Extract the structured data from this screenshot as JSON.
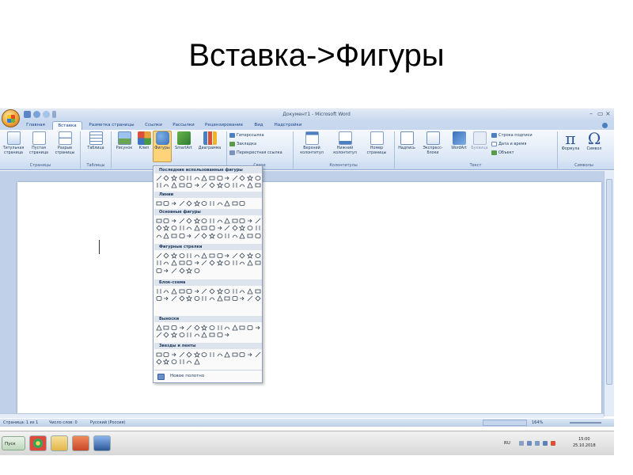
{
  "slide": {
    "title": "Вставка->Фигуры"
  },
  "window": {
    "title": "Документ1 - Microsoft Word",
    "controls": [
      "–",
      "▭",
      "×"
    ]
  },
  "tabs": [
    {
      "label": "Главная",
      "active": false
    },
    {
      "label": "Вставка",
      "active": true
    },
    {
      "label": "Разметка страницы",
      "active": false
    },
    {
      "label": "Ссылки",
      "active": false
    },
    {
      "label": "Рассылки",
      "active": false
    },
    {
      "label": "Рецензирование",
      "active": false
    },
    {
      "label": "Вид",
      "active": false
    },
    {
      "label": "Надстройки",
      "active": false
    }
  ],
  "ribbon": {
    "pages": {
      "label": "Страницы",
      "cover": "Титульная страница",
      "blank": "Пустая страница",
      "break": "Разрыв страницы"
    },
    "tables": {
      "label": "Таблицы",
      "table": "Таблица"
    },
    "illustrations": {
      "picture": "Рисунок",
      "clip": "Клип",
      "shapes": "Фигуры",
      "smartart": "SmartArt",
      "chart": "Диаграмма"
    },
    "links": {
      "label": "Связи",
      "hyperlink": "Гиперссылка",
      "bookmark": "Закладка",
      "crossref": "Перекрестная ссылка"
    },
    "header_footer": {
      "label": "Колонтитулы",
      "header": "Верхний колонтитул",
      "footer": "Нижний колонтитул",
      "page_number": "Номер страницы"
    },
    "text": {
      "label": "Текст",
      "textbox": "Надпись",
      "quickparts": "Экспресс-блоки",
      "wordart": "WordArt",
      "dropcap": "Буквица",
      "signature": "Строка подписи",
      "datetime": "Дата и время",
      "object": "Объект"
    },
    "symbols": {
      "label": "Символы",
      "formula": "Формула",
      "symbol": "Символ",
      "pi": "π",
      "omega": "Ω"
    }
  },
  "shapes_menu": {
    "recent": "Последние использованные фигуры",
    "lines": "Линии",
    "basic": "Основные фигуры",
    "arrows": "Фигурные стрелки",
    "flowchart": "Блок-схема",
    "callouts": "Выноски",
    "stars": "Звезды и ленты",
    "new_canvas": "Новое полотно"
  },
  "status": {
    "page": "Страница: 1 из 1",
    "words": "Число слов: 0",
    "language": "Русский (Россия)",
    "zoom": "164%"
  },
  "taskbar": {
    "start": "Пуск",
    "lang": "RU",
    "time": "15:00",
    "date": "25.10.2018"
  },
  "colors": {
    "ribbon_bg": "#dde8f6",
    "tab_text": "#15428b",
    "accent_active": "#ffd37a",
    "doc_bg": "#bfd0e8"
  }
}
